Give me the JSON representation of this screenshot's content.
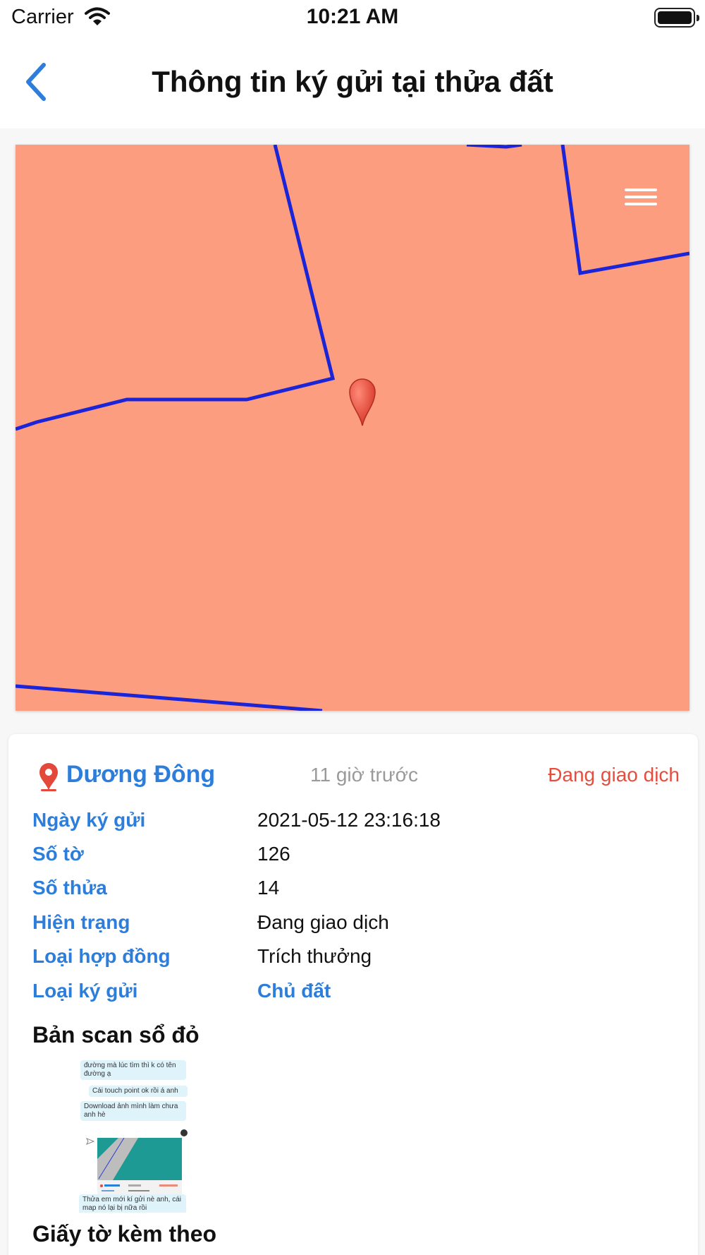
{
  "status_bar": {
    "carrier": "Carrier",
    "time": "10:21 AM"
  },
  "nav": {
    "title": "Thông tin ký gửi tại thửa đất"
  },
  "map": {
    "fill_color": "#fd9d7f",
    "boundary_color": "#1b24d6",
    "pin_color": "#e3483a"
  },
  "listing": {
    "location": "Dương Đông",
    "time_ago": "11 giờ trước",
    "status": "Đang giao dịch",
    "details": [
      {
        "label": "Ngày ký gửi",
        "value": "2021-05-12 23:16:18"
      },
      {
        "label": "Số tờ",
        "value": "126"
      },
      {
        "label": "Số thửa",
        "value": "14"
      },
      {
        "label": "Hiện trạng",
        "value": "Đang giao dịch"
      },
      {
        "label": "Loại hợp đồng",
        "value": "Trích thưởng"
      },
      {
        "label": "Loại ký gửi",
        "value": "Chủ đất"
      }
    ]
  },
  "sections": {
    "scan_title": "Bản scan sổ đỏ",
    "attachments_title": "Giấy tờ kèm theo"
  },
  "scan_thumbnail": {
    "messages": [
      "đường mà lúc tìm thì k có tên đường ạ",
      "Cái touch point ok rồi á anh",
      "Download ảnh mình làm chưa anh hè",
      "Thửa em mới kí gửi nè anh, cái map nó lại bị nữa rồi"
    ]
  }
}
